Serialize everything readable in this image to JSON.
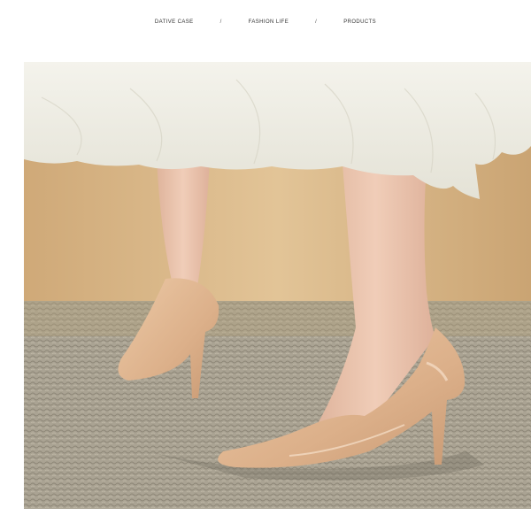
{
  "nav": {
    "items": [
      "DATIVE CASE",
      "FASHION LIFE",
      "PRODUCTS"
    ],
    "separator": "/"
  },
  "photo": {
    "subject": "nude-patent-pointed-high-heel-pumps",
    "colors": {
      "wall": "#d9b98a",
      "rug": "#a9a293",
      "skirt": "#efeee6",
      "shoe": "#e0b894",
      "skin": "#e9c3ae"
    }
  }
}
